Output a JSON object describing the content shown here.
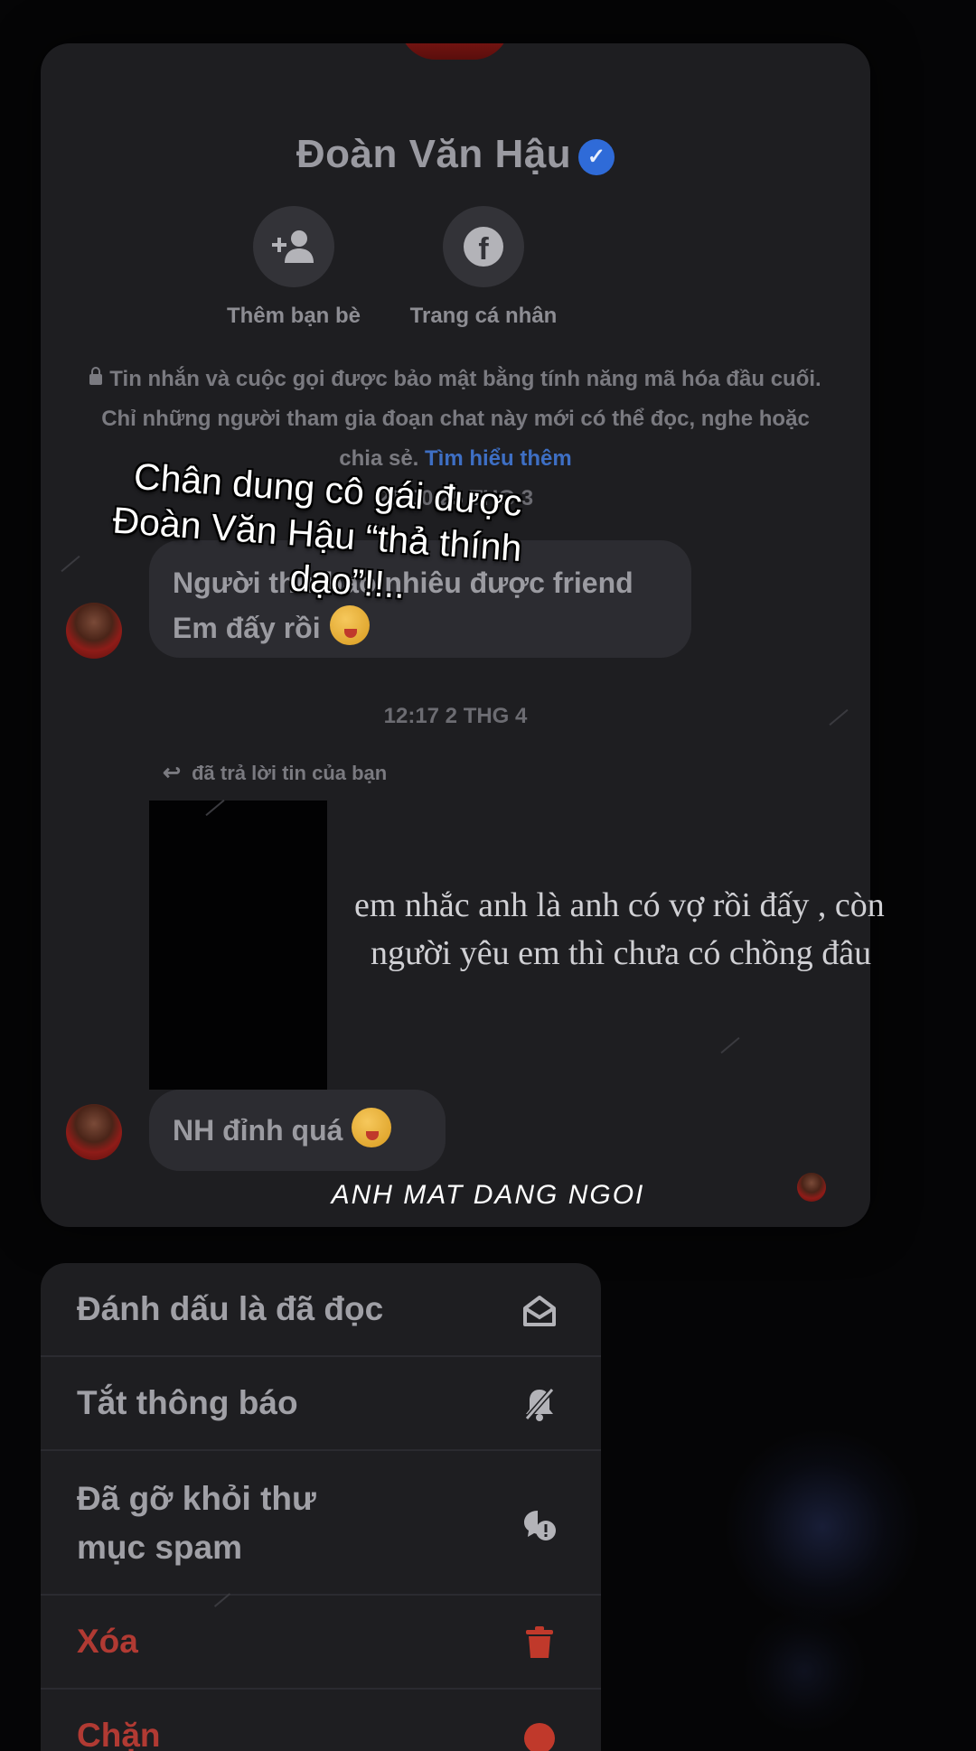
{
  "contact": {
    "name": "Đoàn Văn Hậu",
    "verified_icon": "verified-badge-icon"
  },
  "actions": {
    "add_friend": {
      "label": "Thêm bạn bè",
      "icon": "add-friend-icon"
    },
    "profile": {
      "label": "Trang cá nhân",
      "icon": "facebook-icon"
    }
  },
  "encryption_notice": {
    "text": "Tin nhắn và cuộc gọi được bảo mật bằng tính năng mã hóa đầu cuối. Chỉ những người tham gia đoạn chat này mới có thể đọc, nghe hoặc chia sẻ.",
    "link": "Tìm hiểu thêm"
  },
  "messages": {
    "timestamp1": "21:00 25 THG 3",
    "bubble1_line1": "Người thứ bao nhiêu được friend",
    "bubble1_line2": "Em đấy rồi",
    "timestamp2": "12:17 2 THG 4",
    "reply_label": "đã trả lời tin của bạn",
    "bubble2": "NH đỉnh quá"
  },
  "overlay": {
    "line1": "em nhắc anh là anh có vợ rồi đấy , còn",
    "line2": "người yêu em thì chưa có chồng đâu"
  },
  "caption": {
    "line1": "Chân dung cô gái được",
    "line2": "Đoàn Văn Hậu “thả thính",
    "line3": "dạo”!!.."
  },
  "watermark": "ANH MAT DANG NGOI",
  "menu": {
    "mark_read": "Đánh dấu là đã đọc",
    "mute": "Tắt thông báo",
    "spam_line1": "Đã gỡ khỏi thư",
    "spam_line2": "mục spam",
    "delete": "Xóa",
    "block": "Chặn"
  },
  "colors": {
    "panel": "#1e1e21",
    "bubble": "#2c2c31",
    "link": "#3e6fc4",
    "danger": "#b13a33"
  }
}
